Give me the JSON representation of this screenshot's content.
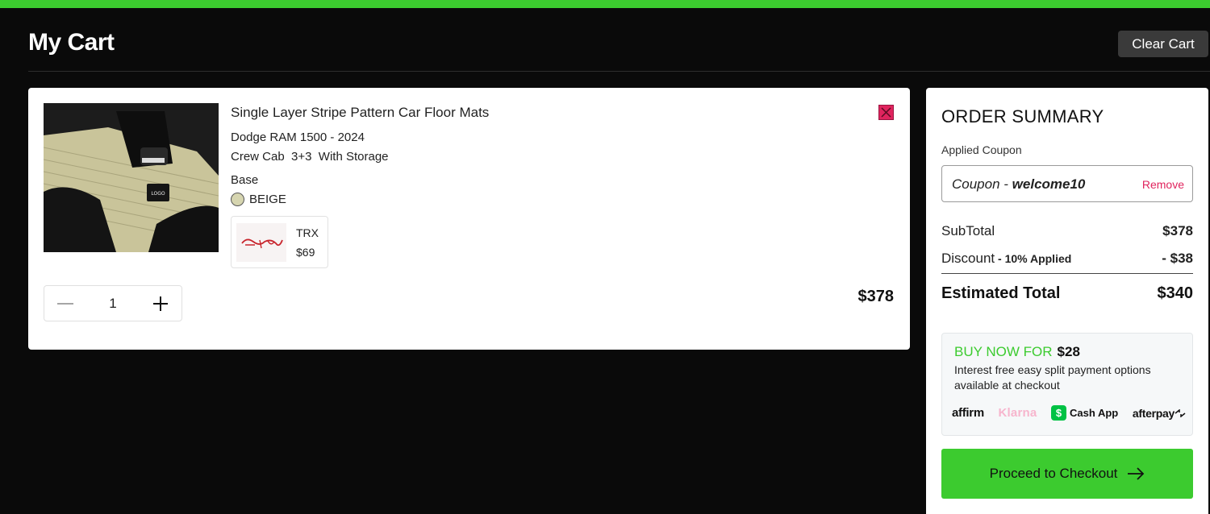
{
  "header": {
    "title": "My Cart",
    "clear_cart_label": "Clear Cart"
  },
  "cart": {
    "items": [
      {
        "title": "Single Layer Stripe Pattern Car Floor Mats",
        "vehicle": "Dodge RAM 1500 - 2024",
        "config": "Crew Cab  3+3  With Storage",
        "trim": "Base",
        "color_name": "BEIGE",
        "color_hex": "#d6d5b0",
        "addon": {
          "name": "TRX",
          "price": "$69"
        },
        "quantity": "1",
        "line_total": "$378"
      }
    ]
  },
  "summary": {
    "title": "ORDER SUMMARY",
    "applied_coupon_label": "Applied Coupon",
    "coupon_prefix": "Coupon - ",
    "coupon_code": "welcome10",
    "coupon_remove_label": "Remove",
    "subtotal_label": "SubTotal",
    "subtotal_value": "$378",
    "discount_label": "Discount",
    "discount_note": " - 10% Applied",
    "discount_value": "- $38",
    "total_label": "Estimated Total",
    "total_value": "$340",
    "bnpl": {
      "headline": "BUY NOW FOR",
      "amount": "$28",
      "description": "Interest free easy split payment options available at checkout",
      "providers": [
        "affirm",
        "Klarna",
        "Cash App",
        "afterpay"
      ]
    },
    "checkout_label": "Proceed to Checkout"
  },
  "colors": {
    "accent_green": "#3ccb2f",
    "remove_pink": "#e0245e",
    "background": "#0a0a0a"
  }
}
